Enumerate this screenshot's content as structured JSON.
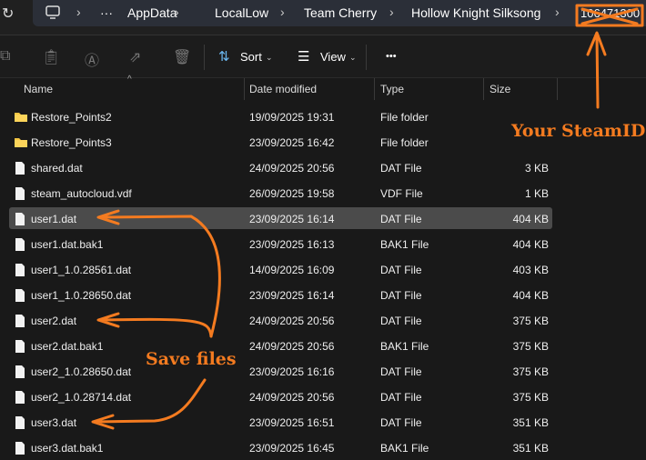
{
  "address": {
    "crumbs": [
      "AppData",
      "LocalLow",
      "Team Cherry",
      "Hollow Knight Silksong",
      "106471300"
    ],
    "ellipsis": "···"
  },
  "toolbar": {
    "sort": "Sort",
    "view": "View",
    "more": "•••"
  },
  "columns": {
    "name": "Name",
    "date": "Date modified",
    "type": "Type",
    "size": "Size"
  },
  "files": [
    {
      "name": "Restore_Points2",
      "date": "19/09/2025 19:31",
      "type": "File folder",
      "size": "",
      "icon": "folder"
    },
    {
      "name": "Restore_Points3",
      "date": "23/09/2025 16:42",
      "type": "File folder",
      "size": "",
      "icon": "folder"
    },
    {
      "name": "shared.dat",
      "date": "24/09/2025 20:56",
      "type": "DAT File",
      "size": "3 KB",
      "icon": "file"
    },
    {
      "name": "steam_autocloud.vdf",
      "date": "26/09/2025 19:58",
      "type": "VDF File",
      "size": "1 KB",
      "icon": "file"
    },
    {
      "name": "user1.dat",
      "date": "23/09/2025 16:14",
      "type": "DAT File",
      "size": "404 KB",
      "icon": "file",
      "selected": true
    },
    {
      "name": "user1.dat.bak1",
      "date": "23/09/2025 16:13",
      "type": "BAK1 File",
      "size": "404 KB",
      "icon": "file"
    },
    {
      "name": "user1_1.0.28561.dat",
      "date": "14/09/2025 16:09",
      "type": "DAT File",
      "size": "403 KB",
      "icon": "file"
    },
    {
      "name": "user1_1.0.28650.dat",
      "date": "23/09/2025 16:14",
      "type": "DAT File",
      "size": "404 KB",
      "icon": "file"
    },
    {
      "name": "user2.dat",
      "date": "24/09/2025 20:56",
      "type": "DAT File",
      "size": "375 KB",
      "icon": "file"
    },
    {
      "name": "user2.dat.bak1",
      "date": "24/09/2025 20:56",
      "type": "BAK1 File",
      "size": "375 KB",
      "icon": "file"
    },
    {
      "name": "user2_1.0.28650.dat",
      "date": "23/09/2025 16:16",
      "type": "DAT File",
      "size": "375 KB",
      "icon": "file"
    },
    {
      "name": "user2_1.0.28714.dat",
      "date": "24/09/2025 20:56",
      "type": "DAT File",
      "size": "375 KB",
      "icon": "file"
    },
    {
      "name": "user3.dat",
      "date": "23/09/2025 16:51",
      "type": "DAT File",
      "size": "351 KB",
      "icon": "file"
    },
    {
      "name": "user3.dat.bak1",
      "date": "23/09/2025 16:45",
      "type": "BAK1 File",
      "size": "351 KB",
      "icon": "file"
    }
  ],
  "annotations": {
    "steamid": "Your SteamID",
    "save": "Save files",
    "color": "#f47b20"
  }
}
